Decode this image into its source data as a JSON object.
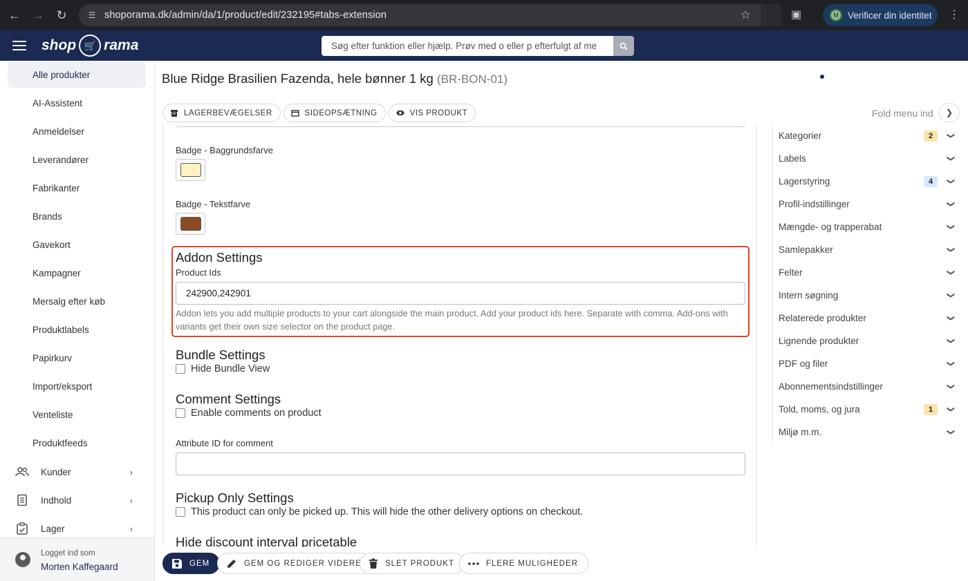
{
  "browser": {
    "url": "shoporama.dk/admin/da/1/product/edit/232195#tabs-extension",
    "profile_button": "Verificer din identitet",
    "profile_initial": "M"
  },
  "header": {
    "logo_left": "shop",
    "logo_right": "rama",
    "search_placeholder": "Søg efter funktion eller hjælp. Prøv med o eller p efterfulgt af me"
  },
  "sidebar": {
    "items": [
      {
        "label": "Alle produkter",
        "active": true
      },
      {
        "label": "AI-Assistent"
      },
      {
        "label": "Anmeldelser"
      },
      {
        "label": "Leverandører"
      },
      {
        "label": "Fabrikanter"
      },
      {
        "label": "Brands"
      },
      {
        "label": "Gavekort"
      },
      {
        "label": "Kampagner"
      },
      {
        "label": "Mersalg efter køb"
      },
      {
        "label": "Produktlabels"
      },
      {
        "label": "Papirkurv"
      },
      {
        "label": "Import/eksport"
      },
      {
        "label": "Venteliste"
      },
      {
        "label": "Produktfeeds"
      }
    ],
    "groups": [
      {
        "label": "Kunder",
        "icon": "people-icon"
      },
      {
        "label": "Indhold",
        "icon": "document-icon"
      },
      {
        "label": "Lager",
        "icon": "clipboard-icon"
      }
    ],
    "footer": {
      "logged_in_label": "Logget ind som",
      "user_name": "Morten Kaffegaard"
    }
  },
  "page": {
    "title": "Blue Ridge Brasilien Fazenda, hele bønner 1 kg",
    "sku": "(BR-BON-01)",
    "tabs": [
      {
        "label": "LAGERBEVÆGELSER",
        "icon": "archive-icon"
      },
      {
        "label": "SIDEOPSÆTNING",
        "icon": "layout-icon"
      },
      {
        "label": "VIS PRODUKT",
        "icon": "eye-icon"
      }
    ],
    "fold_label": "Fold menu ind"
  },
  "form": {
    "badge_bg_label": "Badge - Baggrundsfarve",
    "badge_bg_color": "#fdf3c4",
    "badge_text_label": "Badge - Tekstfarve",
    "badge_text_color": "#8a4a22",
    "addon": {
      "title": "Addon Settings",
      "field_label": "Product Ids",
      "field_value": "242900,242901",
      "help": "Addon lets you add multiple products to your cart alongside the main product. Add your product ids here. Separate with comma. Add-ons with variants get their own size selector on the product page."
    },
    "bundle": {
      "title": "Bundle Settings",
      "checkbox": "Hide Bundle View"
    },
    "comment": {
      "title": "Comment Settings",
      "checkbox": "Enable comments on product",
      "attr_label": "Attribute ID for comment",
      "attr_value": ""
    },
    "pickup": {
      "title": "Pickup Only Settings",
      "checkbox": "This product can only be picked up. This will hide the other delivery options on checkout."
    },
    "discount_title": "Hide discount interval pricetable"
  },
  "right_panel": {
    "items": [
      {
        "label": "Kategorier",
        "badge": "2",
        "badge_color": "#fde3a7"
      },
      {
        "label": "Labels"
      },
      {
        "label": "Lagerstyring",
        "badge": "4",
        "badge_color": "#d6e8fb"
      },
      {
        "label": "Profil-indstillinger"
      },
      {
        "label": "Mængde- og trapperabat"
      },
      {
        "label": "Samlepakker"
      },
      {
        "label": "Felter"
      },
      {
        "label": "Intern søgning"
      },
      {
        "label": "Relaterede produkter"
      },
      {
        "label": "Lignende produkter"
      },
      {
        "label": "PDF og filer"
      },
      {
        "label": "Abonnementsindstillinger"
      },
      {
        "label": "Told, moms, og jura",
        "badge": "1",
        "badge_color": "#fde3a7"
      },
      {
        "label": "Miljø m.m."
      }
    ]
  },
  "actions": {
    "save": "GEM",
    "save_continue": "GEM OG REDIGER VIDERE",
    "delete": "SLET PRODUKT",
    "more": "FLERE MULIGHEDER"
  },
  "colors": {
    "header_bg": "#1b2a52",
    "highlight_border": "#e0432a"
  }
}
